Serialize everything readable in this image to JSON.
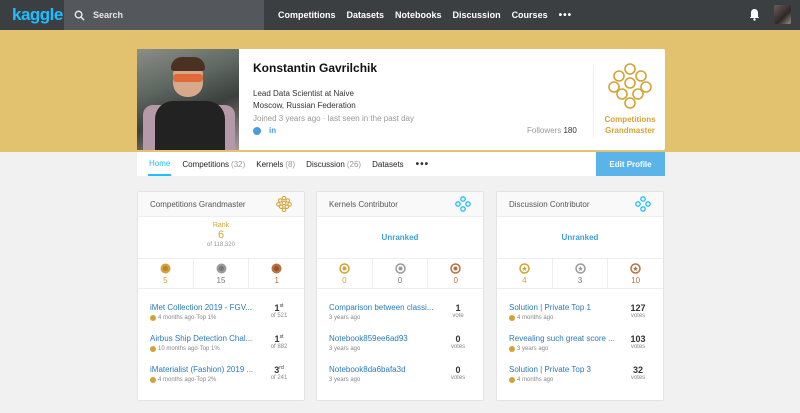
{
  "header": {
    "logo": "kaggle",
    "search_placeholder": "Search",
    "nav": [
      "Competitions",
      "Datasets",
      "Notebooks",
      "Discussion",
      "Courses"
    ],
    "more": "•••"
  },
  "profile": {
    "name": "Konstantin Gavrilchik",
    "title": "Lead Data Scientist at Naive",
    "location": "Moscow, Russian Federation",
    "joined": "Joined 3 years ago · last seen in the past day",
    "linkedin": "in",
    "followers_label": "Followers",
    "followers_count": "180",
    "tier": "Competitions Grandmaster"
  },
  "tabs": {
    "home": "Home",
    "competitions": "Competitions",
    "competitions_count": "(32)",
    "kernels": "Kernels",
    "kernels_count": "(8)",
    "discussion": "Discussion",
    "discussion_count": "(26)",
    "datasets": "Datasets",
    "more": "•••",
    "edit_profile": "Edit Profile"
  },
  "colors": {
    "brand": "#20beff",
    "gold": "#d3a335",
    "silver": "#9a9a9a",
    "bronze": "#b9703f",
    "banner": "#e2c26f"
  },
  "columns": [
    {
      "title": "Competitions Grandmaster",
      "icon": "grandmaster-badge-icon",
      "rank_label": "Rank",
      "rank": "6",
      "rank_of": "of 118,320",
      "medals": {
        "gold": "5",
        "silver": "15",
        "bronze": "1"
      },
      "rows": [
        {
          "title": "iMet Collection 2019 - FGV...",
          "sub": "4 months ago·Top 1%",
          "main": "1",
          "sup": "st",
          "small": "of 521"
        },
        {
          "title": "Airbus Ship Detection Chal...",
          "sub": "10 months ago·Top 1%",
          "main": "1",
          "sup": "st",
          "small": "of 882"
        },
        {
          "title": "iMaterialist (Fashion) 2019 ...",
          "sub": "4 months ago·Top 2%",
          "main": "3",
          "sup": "rd",
          "small": "of 241"
        }
      ]
    },
    {
      "title": "Kernels Contributor",
      "icon": "contributor-badge-icon",
      "unranked": "Unranked",
      "medals": {
        "gold": "0",
        "silver": "0",
        "bronze": "0"
      },
      "rows": [
        {
          "title": "Comparison between classi...",
          "sub": "3 years ago",
          "main": "1",
          "small": "vote"
        },
        {
          "title": "Notebook859ee6ad93",
          "sub": "3 years ago",
          "main": "0",
          "small": "votes"
        },
        {
          "title": "Notebook8da6bafa3d",
          "sub": "3 years ago",
          "main": "0",
          "small": "votes"
        }
      ]
    },
    {
      "title": "Discussion Contributor",
      "icon": "contributor-badge-icon",
      "unranked": "Unranked",
      "medals": {
        "gold": "4",
        "silver": "3",
        "bronze": "10"
      },
      "rows": [
        {
          "title": "Solution | Private Top 1",
          "sub": "4 months ago",
          "main": "127",
          "small": "votes"
        },
        {
          "title": "Revealing such great score ...",
          "sub": "3 years ago",
          "main": "103",
          "small": "votes"
        },
        {
          "title": "Solution | Private Top 3",
          "sub": "4 months ago",
          "main": "32",
          "small": "votes"
        }
      ]
    }
  ]
}
